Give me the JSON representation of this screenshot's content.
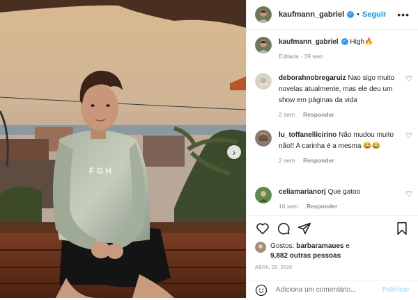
{
  "post": {
    "author": "kaufmann_gabriel",
    "follow_label": "Seguir",
    "more_icon": "more-options-icon",
    "caption": "High🔥",
    "caption_meta": "Editada · 39 sem"
  },
  "comments": [
    {
      "user": "deborahnobregaruiz",
      "text": "Nao sigo muito novelas atualmente, mas ele deu um show em páginas da vida",
      "time": "2 sem",
      "reply": "Responder"
    },
    {
      "user": "lu_toffanellicirino",
      "text": "Não mudou muito não!! A carinha é a mesma 😂😂",
      "time": "2 sem",
      "reply": "Responder"
    },
    {
      "user": "celiamarianorj",
      "text": "Que gatoo",
      "time": "16 sem",
      "reply": "Responder"
    }
  ],
  "likes": {
    "prefix": "Gostos: ",
    "user": "barbaramaues",
    "conj": " e",
    "others": "9,882 outras pessoas"
  },
  "date": "ABRIL 26, 2020",
  "add_comment": {
    "placeholder": "Adiciona um comentário...",
    "publish": "Publicar"
  },
  "colors": {
    "accent": "#0095f6",
    "verified": "#3897f0",
    "muted": "#8e8e8e"
  }
}
